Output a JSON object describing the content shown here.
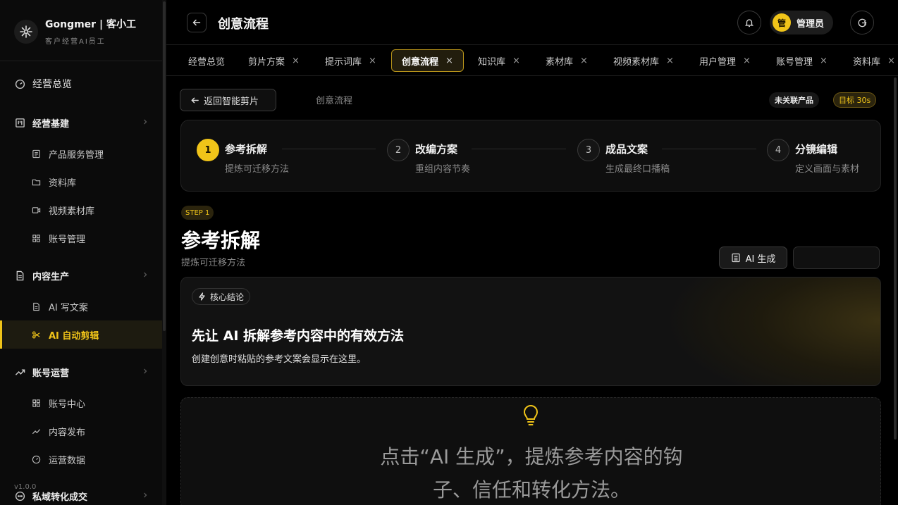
{
  "brand": {
    "name": "Gongmer | 客小工",
    "subtitle": "客户经营AI员工"
  },
  "sidebar": {
    "overview": "经营总览",
    "groups": [
      {
        "label": "经营基建",
        "items": [
          "产品服务管理",
          "资料库",
          "视频素材库",
          "账号管理"
        ]
      },
      {
        "label": "内容生产",
        "items": [
          "AI 写文案",
          "AI 自动剪辑"
        ]
      },
      {
        "label": "账号运营",
        "items": [
          "账号中心",
          "内容发布",
          "运营数据"
        ]
      },
      {
        "label": "私域转化成交",
        "items": []
      }
    ],
    "active_item": "AI 自动剪辑",
    "version": "v1.0.0"
  },
  "header": {
    "title": "创意流程",
    "user": {
      "avatar": "管",
      "name": "管理员"
    }
  },
  "tabs": [
    {
      "label": "经营总览",
      "closable": false
    },
    {
      "label": "剪片方案",
      "closable": true
    },
    {
      "label": "提示词库",
      "closable": true
    },
    {
      "label": "创意流程",
      "closable": true,
      "active": true
    },
    {
      "label": "知识库",
      "closable": true
    },
    {
      "label": "素材库",
      "closable": true
    },
    {
      "label": "视频素材库",
      "closable": true
    },
    {
      "label": "用户管理",
      "closable": true
    },
    {
      "label": "账号管理",
      "closable": true
    },
    {
      "label": "资料库",
      "closable": true
    }
  ],
  "close_glyph": "×",
  "toolbar": {
    "back_label": "返回智能剪片",
    "breadcrumb": "创意流程",
    "product_badge": "未关联产品",
    "target_badge": "目标 30s"
  },
  "steps": [
    {
      "num": "1",
      "title": "参考拆解",
      "subtitle": "提炼可迁移方法",
      "active": true
    },
    {
      "num": "2",
      "title": "改编方案",
      "subtitle": "重组内容节奏"
    },
    {
      "num": "3",
      "title": "成品文案",
      "subtitle": "生成最终口播稿"
    },
    {
      "num": "4",
      "title": "分镜编辑",
      "subtitle": "定义画面与素材"
    }
  ],
  "section": {
    "step_badge": "STEP 1",
    "title": "参考拆解",
    "subtitle": "提炼可迁移方法",
    "ai_button": "AI 生成"
  },
  "core_card": {
    "tag": "核心结论",
    "title": "先让 AI 拆解参考内容中的有效方法",
    "description": "创建创意时粘贴的参考文案会显示在这里。"
  },
  "empty_state": {
    "line1": "点击“AI 生成”，提炼参考内容的钩",
    "line2": "子、信任和转化方法。"
  },
  "colors": {
    "accent": "#f0c419",
    "background": "#000000",
    "panel": "#0e0e0e"
  }
}
